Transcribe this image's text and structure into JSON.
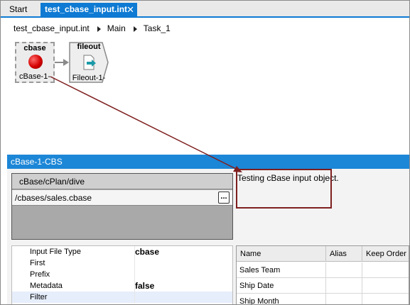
{
  "tabs": [
    {
      "label": "Start",
      "active": false
    },
    {
      "label": "test_cbase_input.int",
      "active": true,
      "close": "✕"
    }
  ],
  "breadcrumb": [
    "test_cbase_input.int",
    "Main",
    "Task_1"
  ],
  "canvas": {
    "nodes": [
      {
        "title": "cbase",
        "caption": "cBase-1-",
        "icon": "red-ball-icon",
        "selected": true
      },
      {
        "title": "fileout",
        "caption": "Fileout-1-",
        "icon": "file-arrow-icon"
      }
    ]
  },
  "panel": {
    "title": "cBase-1-CBS",
    "grid_header": "cBase/cPlan/dive",
    "grid_value": "/cbases/sales.cbase",
    "ellipsis": "...",
    "note": "Testing cBase input object."
  },
  "properties": [
    {
      "name": "Input File Type",
      "value": "cbase"
    },
    {
      "name": "First",
      "value": ""
    },
    {
      "name": "Prefix",
      "value": ""
    },
    {
      "name": "Metadata",
      "value": "false"
    },
    {
      "name": "Filter",
      "value": ""
    }
  ],
  "fields_table": {
    "columns": [
      "Name",
      "Alias",
      "Keep Order"
    ],
    "rows": [
      [
        "Sales Team",
        "",
        ""
      ],
      [
        "Ship Date",
        "",
        ""
      ],
      [
        "Ship Month",
        "",
        ""
      ]
    ]
  },
  "colors": {
    "accent": "#0e7ad3",
    "callout": "#7f1f1f"
  }
}
